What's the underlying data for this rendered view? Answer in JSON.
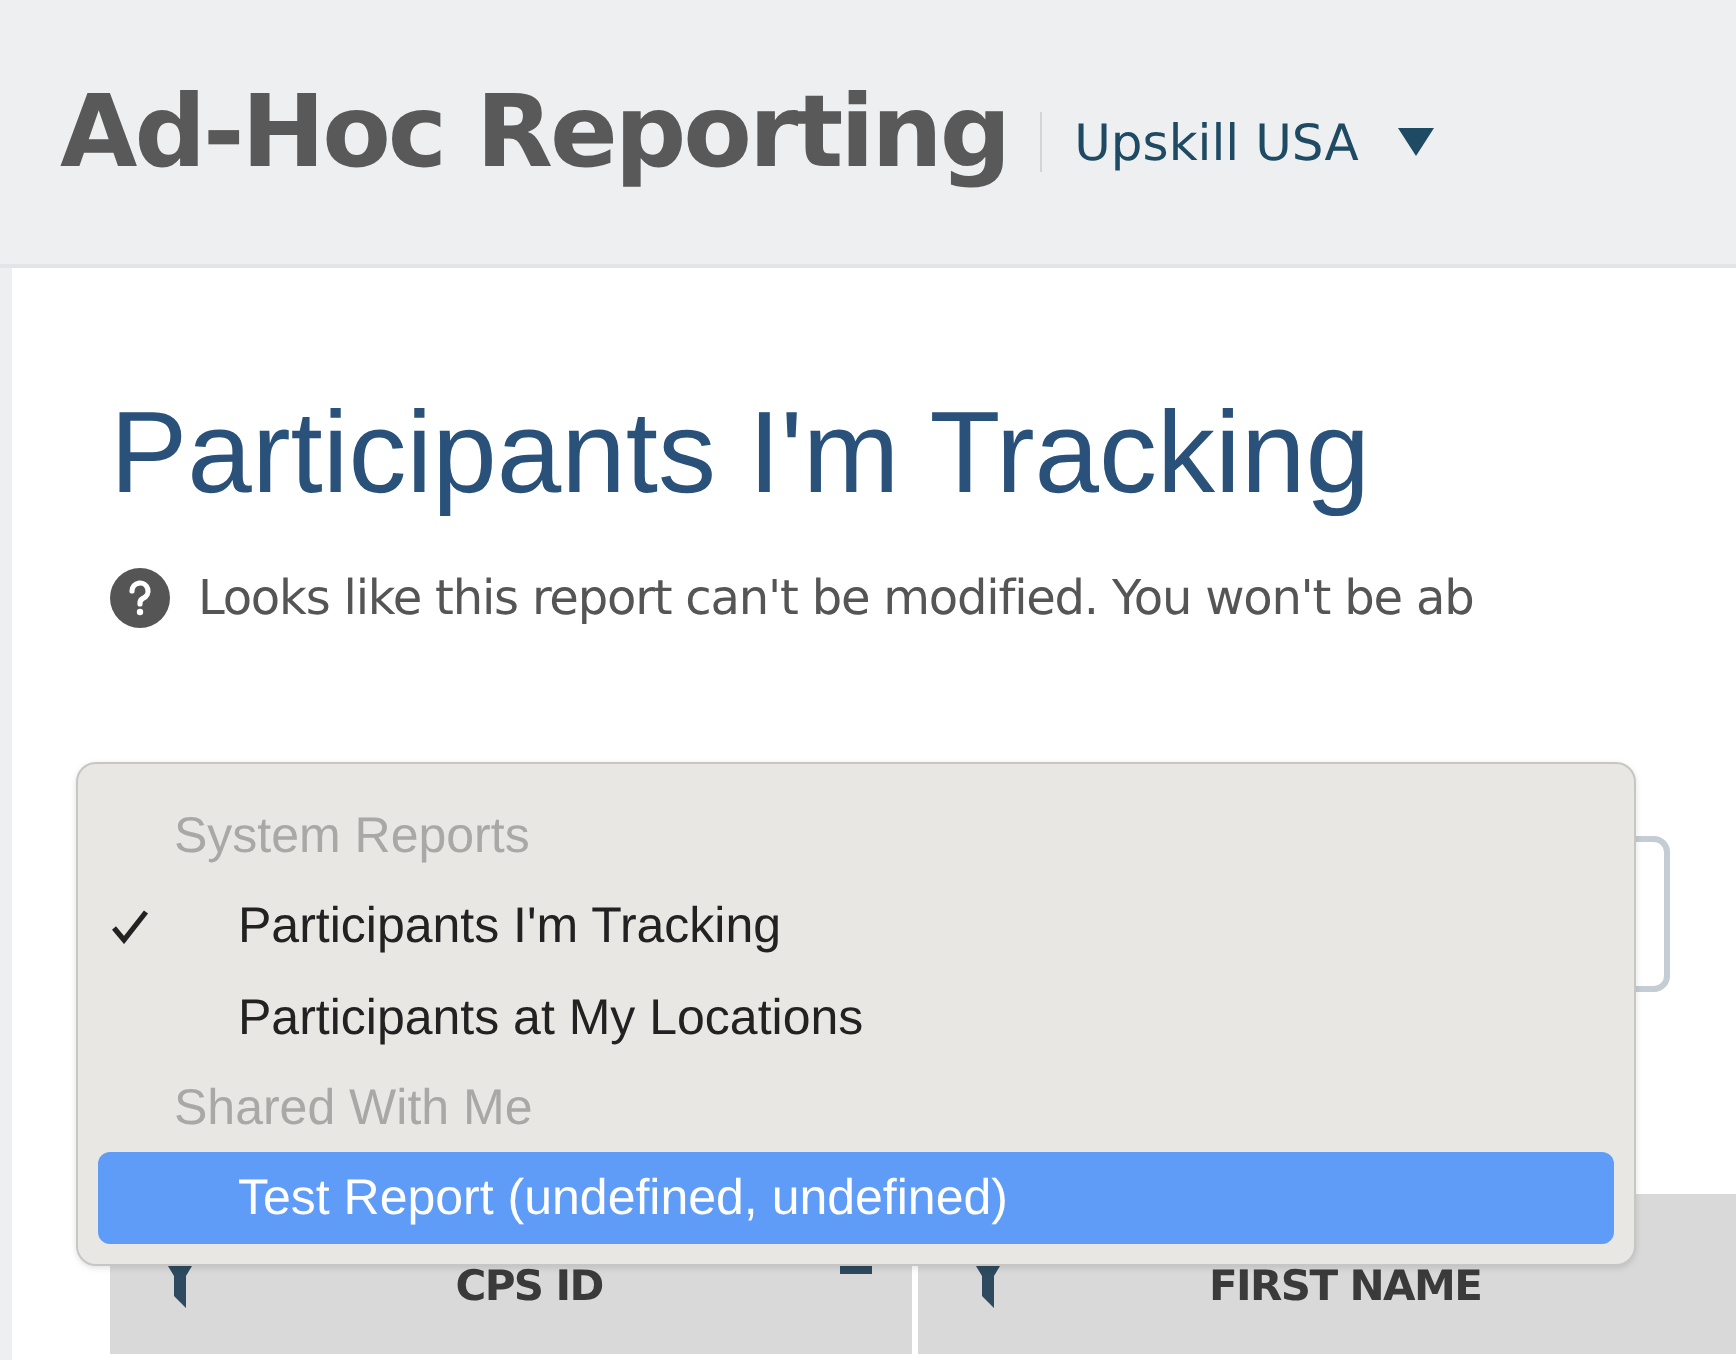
{
  "header": {
    "title": "Ad-Hoc Reporting",
    "organization": "Upskill USA"
  },
  "page": {
    "title": "Participants I'm Tracking",
    "notice": "Looks like this report can't be modified. You won't be ab"
  },
  "report_menu": {
    "groups": [
      {
        "label": "System Reports",
        "items": [
          {
            "label": "Participants I'm Tracking",
            "checked": true,
            "selected": false
          },
          {
            "label": "Participants at My Locations",
            "checked": false,
            "selected": false
          }
        ]
      },
      {
        "label": "Shared With Me",
        "items": [
          {
            "label": "Test Report (undefined, undefined)",
            "checked": false,
            "selected": true
          }
        ]
      }
    ]
  },
  "table": {
    "columns": [
      {
        "label": "CPS ID",
        "sortable": true
      },
      {
        "label": "FIRST NAME",
        "sortable": false
      }
    ]
  }
}
